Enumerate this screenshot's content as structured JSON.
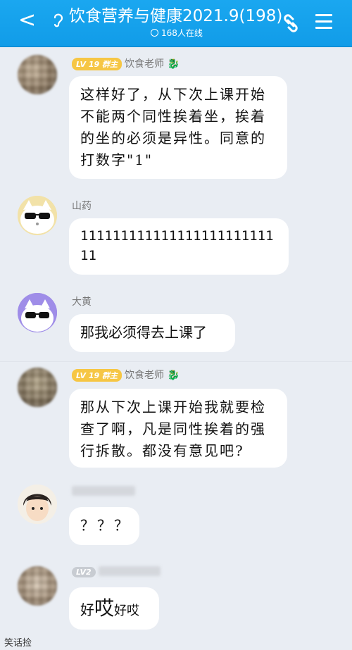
{
  "header": {
    "back": "<",
    "title": "饮食营养与健康2021.9(198)",
    "online": "168人在线"
  },
  "messages": [
    {
      "sender_level": "LV 19",
      "sender_role": "群主",
      "sender_name": "饮食老师",
      "text": "这样好了，从下次上课开始不能两个同性挨着坐，挨着的坐的必须是异性。同意的打数字\"1\""
    },
    {
      "sender_name": "山药",
      "text": "11111111111111111111111111"
    },
    {
      "sender_name": "大黄",
      "text": "那我必须得去上课了"
    },
    {
      "sender_level": "LV 19",
      "sender_role": "群主",
      "sender_name": "饮食老师",
      "text": "那从下次上课开始我就要检查了啊，凡是同性挨着的强行拆散。都没有意见吧?"
    },
    {
      "text": "？？？"
    },
    {
      "sender_level": "LV2",
      "text_parts": [
        "好",
        "哎",
        "好哎"
      ]
    }
  ],
  "watermark": "笑话捡",
  "colors": {
    "header": "#119ce8",
    "background": "#e9edf3",
    "bubble": "#ffffff",
    "level_badge": "#f6c644"
  }
}
